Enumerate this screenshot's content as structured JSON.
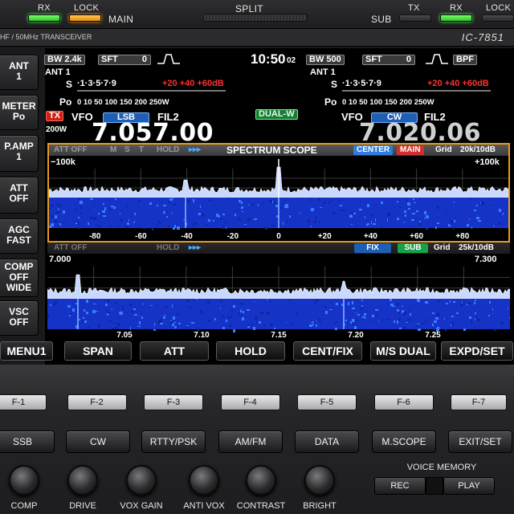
{
  "top": {
    "rx_label": "RX",
    "lock_label": "LOCK",
    "main_label": "MAIN",
    "split_label": "SPLIT",
    "sub_label": "SUB",
    "tx_label": "TX",
    "rx2_label": "RX",
    "lock2_label": "LOCK"
  },
  "model": {
    "description": "HF / 50MHz TRANSCEIVER",
    "name": "IC-7851"
  },
  "left_buttons": [
    {
      "line1": "ANT",
      "line2": "1"
    },
    {
      "line1": "METER",
      "line2": "Po"
    },
    {
      "line1": "P.AMP",
      "line2": "1"
    },
    {
      "line1": "ATT",
      "line2": "OFF"
    },
    {
      "line1": "AGC",
      "line2": "FAST"
    },
    {
      "line1": "COMP",
      "line2": "OFF",
      "line3": "WIDE"
    },
    {
      "line1": "VSC",
      "line2": "OFF"
    }
  ],
  "main": {
    "bw": "BW 2.4k",
    "sft": "SFT",
    "sft_val": "0",
    "clock": "10:50",
    "clock_sec": "02",
    "ant": "ANT 1",
    "s_label": "S",
    "s_scale": "·1·3·5·7·9",
    "s_over": "+20 +40 +60dB",
    "po_label": "Po",
    "po_scale": "0  10    50   100 150 200 250W",
    "tx": "TX",
    "power": "200W",
    "vfo": "VFO",
    "mode": "LSB",
    "filter": "FIL2",
    "freq": "7.057.00",
    "dualw": "DUAL-W"
  },
  "sub": {
    "bw": "BW 500",
    "sft": "SFT",
    "sft_val": "0",
    "bpf": "BPF",
    "ant": "ANT 1",
    "s_label": "S",
    "s_scale": "·1·3·5·7·9",
    "s_over": "+20 +40 +60dB",
    "po_label": "Po",
    "po_scale": "0  10    50   100 150 200 250W",
    "vfo": "VFO",
    "mode": "CW",
    "filter": "FIL2",
    "freq": "7.020.06"
  },
  "scope1": {
    "att": "ATT OFF",
    "m": "M",
    "s": "S",
    "t": "T",
    "hold": "HOLD",
    "arrows": "▸▸▸",
    "title": "SPECTRUM SCOPE",
    "center": "CENTER",
    "main": "MAIN",
    "grid": "Grid",
    "grid_val": "20k/10dB",
    "left": "−100k",
    "right": "+100k",
    "ticks": [
      "-80",
      "-60",
      "-40",
      "-20",
      "0",
      "+20",
      "+40",
      "+60",
      "+80"
    ]
  },
  "scope2": {
    "att": "ATT OFF",
    "hold": "HOLD",
    "arrows": "▸▸▸",
    "fix": "FIX",
    "sub": "SUB",
    "grid": "Grid",
    "grid_val": "25k/10dB",
    "left": "7.000",
    "right": "7.300",
    "ticks": [
      "7.05",
      "7.10",
      "7.15",
      "7.20",
      "7.25"
    ]
  },
  "softkeys": [
    "MENU1",
    "SPAN",
    "ATT",
    "HOLD",
    "CENT/FIX",
    "M/S  DUAL",
    "EXPD/SET"
  ],
  "fkeys": [
    "F-1",
    "F-2",
    "F-3",
    "F-4",
    "F-5",
    "F-6",
    "F-7"
  ],
  "modekeys": [
    "SSB",
    "CW",
    "RTTY/PSK",
    "AM/FM",
    "DATA",
    "M.SCOPE",
    "EXIT/SET"
  ],
  "knobs": [
    "COMP",
    "DRIVE",
    "VOX GAIN",
    "ANTI VOX",
    "CONTRAST",
    "BRIGHT"
  ],
  "voice_memory": {
    "title": "VOICE MEMORY",
    "rec": "REC",
    "play": "PLAY"
  },
  "colors": {
    "scope_border": "#e69a1c",
    "waterfall": "#1a3fcf",
    "chip_blue": "#1d5fb5"
  }
}
